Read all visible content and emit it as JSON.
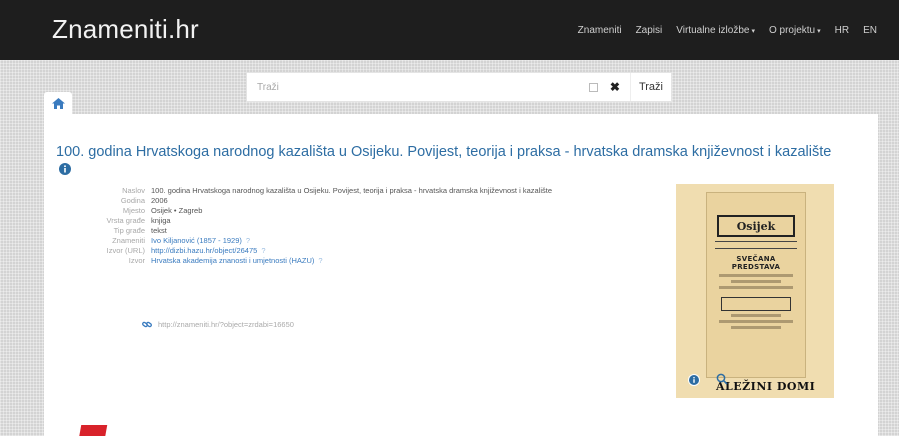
{
  "brand": "Znameniti.hr",
  "nav": {
    "znameniti": "Znameniti",
    "zapisi": "Zapisi",
    "virtualne_izlozbe": "Virtualne izložbe",
    "o_projektu": "O projektu",
    "hr": "HR",
    "en": "EN"
  },
  "search": {
    "placeholder": "Traži",
    "button_label": "Traži",
    "clear_glyph": "✖"
  },
  "record": {
    "title": "100. godina Hrvatskoga narodnog kazališta u Osijeku. Povijest, teorija i praksa - hrvatska dramska književnost i kazalište",
    "fields": [
      {
        "label": "Naslov",
        "value": "100. godina Hrvatskoga narodnog kazališta u Osijeku. Povijest, teorija i praksa - hrvatska dramska književnost i kazalište",
        "link": false
      },
      {
        "label": "Godina",
        "value": "2006",
        "link": false
      },
      {
        "label": "Mjesto",
        "value": "Osijek • Zagreb",
        "link": false
      },
      {
        "label": "Vrsta građe",
        "value": "knjiga",
        "link": false
      },
      {
        "label": "Tip građe",
        "value": "tekst",
        "link": false
      },
      {
        "label": "Znameniti",
        "value": "Ivo Kiljanović (1857 - 1929)",
        "link": true
      },
      {
        "label": "Izvor (URL)",
        "value": "http://dizbi.hazu.hr/object/26475",
        "link": true
      },
      {
        "label": "Izvor",
        "value": "Hrvatska akademija znanosti i umjetnosti (HAZU)",
        "link": true
      }
    ],
    "permalink": "http://znameniti.hr/?object=zrdabi=16650"
  },
  "thumbnail": {
    "poster_head": "Osijek",
    "poster_main": "SVEČANA PREDSTAVA",
    "poster_caption": "ALEŽINI DOMI"
  },
  "colors": {
    "topbar": "#1e1e1e",
    "link": "#2d6da3",
    "accent_red": "#d8222a"
  }
}
